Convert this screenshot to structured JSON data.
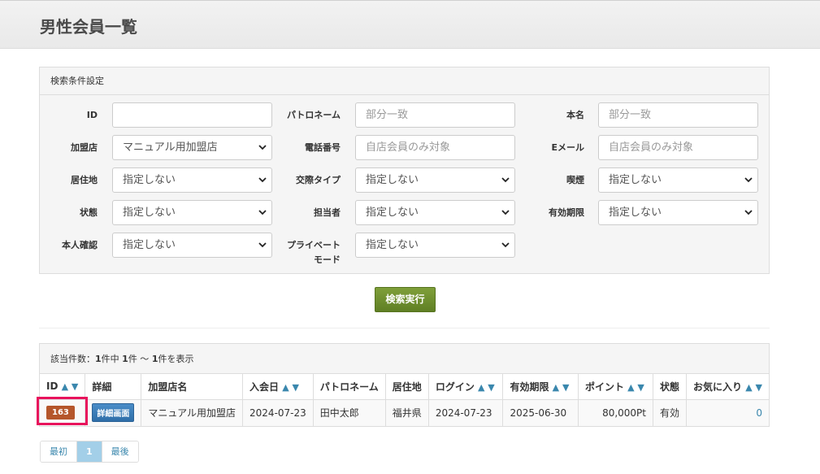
{
  "page": {
    "title": "男性会員一覧"
  },
  "search": {
    "heading": "検索条件設定",
    "labels": {
      "id": "ID",
      "patron_name": "パトロネーム",
      "real_name": "本名",
      "affiliate": "加盟店",
      "phone": "電話番号",
      "email": "Eメール",
      "residence": "居住地",
      "relation_type": "交際タイプ",
      "smoking": "喫煙",
      "status": "状態",
      "staff": "担当者",
      "expiry": "有効期限",
      "identity": "本人確認",
      "private_mode_1": "プライベート",
      "private_mode_2": "モード"
    },
    "values": {
      "id": "",
      "patron_name": "部分一致",
      "real_name": "部分一致",
      "affiliate": "マニュアル用加盟店",
      "phone": "自店会員のみ対象",
      "email": "自店会員のみ対象",
      "residence": "指定しない",
      "relation_type": "指定しない",
      "smoking": "指定しない",
      "status": "指定しない",
      "staff": "指定しない",
      "expiry": "指定しない",
      "identity": "指定しない",
      "private_mode": "指定しない"
    },
    "submit_label": "検索実行"
  },
  "results": {
    "summary_prefix": "該当件数：",
    "summary_total": "1",
    "summary_mid1": "件中 ",
    "summary_from": "1",
    "summary_mid2": "件 〜 ",
    "summary_to": "1",
    "summary_suffix": "件を表示",
    "sort_arrows": "▲ ▼",
    "columns": {
      "id": "ID",
      "detail": "詳細",
      "affiliate": "加盟店名",
      "joined": "入会日",
      "patron": "パトロネーム",
      "residence": "居住地",
      "login": "ログイン",
      "expiry": "有効期限",
      "points": "ポイント",
      "status": "状態",
      "favorites": "お気に入り"
    },
    "row": {
      "id": "163",
      "detail_label": "詳細画面",
      "affiliate": "マニュアル用加盟店",
      "joined": "2024-07-23",
      "patron": "田中太郎",
      "residence": "福井県",
      "login": "2024-07-23",
      "expiry": "2025-06-30",
      "points": "80,000Pt",
      "status": "有効",
      "favorites": "0"
    }
  },
  "pagination": {
    "first": "最初",
    "current": "1",
    "last": "最後"
  },
  "colors": {
    "search_button": "#6b8e2e",
    "id_badge": "#b5562b",
    "detail_button": "#3a7fbf",
    "highlight": "#e8135c",
    "link": "#3a87ad"
  }
}
